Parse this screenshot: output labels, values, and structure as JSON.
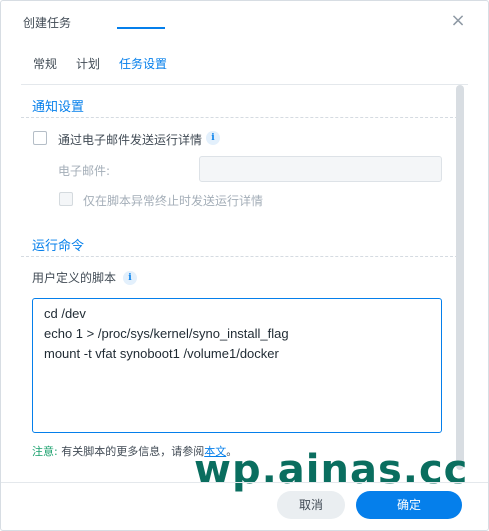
{
  "dialog": {
    "title": "创建任务",
    "close_glyph": "×"
  },
  "tabs": [
    {
      "label": "常规"
    },
    {
      "label": "计划"
    },
    {
      "label": "任务设置"
    }
  ],
  "notification": {
    "section_title": "通知设置",
    "email_checkbox_label": "通过电子邮件发送运行详情",
    "email_field_label": "电子邮件:",
    "email_value": "",
    "abnormal_only_label": "仅在脚本异常终止时发送运行详情"
  },
  "run_command": {
    "section_title": "运行命令",
    "script_label": "用户定义的脚本",
    "script_lines": [
      "cd /dev",
      "echo 1 > /proc/sys/kernel/syno_install_flag",
      "mount -t vfat synoboot1 /volume1/docker"
    ],
    "note_prefix": "注意:",
    "note_text": "有关脚本的更多信息，请参阅",
    "note_link": "本文",
    "note_suffix": "。"
  },
  "footer": {
    "cancel_label": "取消",
    "ok_label": "确定"
  },
  "watermark": "wp.ainas.cc",
  "colors": {
    "accent": "#057feb",
    "note_prefix": "#1aa06d",
    "watermark": "#0a6e5f"
  }
}
